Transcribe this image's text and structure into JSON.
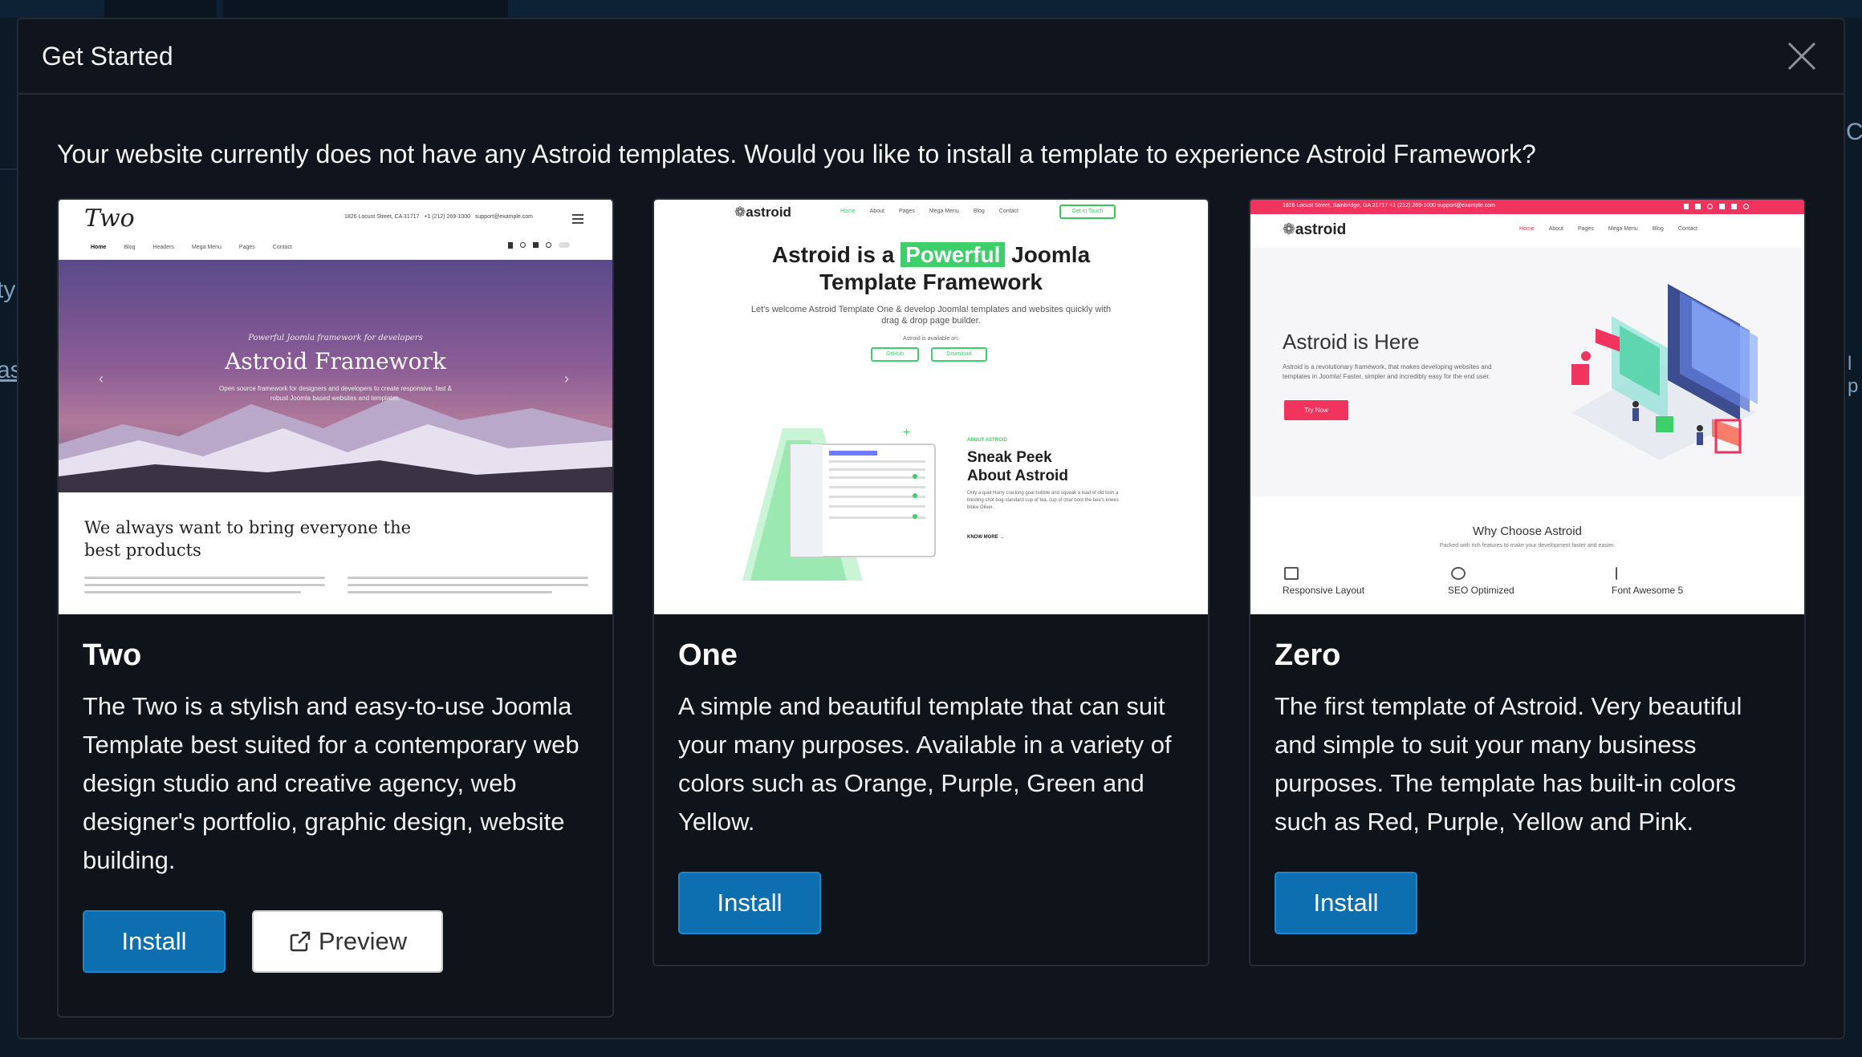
{
  "background": {
    "side_left_1": "ty",
    "side_left_2": "as",
    "side_right_1": "Cle",
    "side_right_2": "l p"
  },
  "modal": {
    "title": "Get Started",
    "close_icon": "close-icon",
    "intro": "Your website currently does not have any Astroid templates. Would you like to install a template to experience Astroid Framework?"
  },
  "templates": [
    {
      "title": "Two",
      "description": "The Two is a stylish and easy-to-use Joomla Template best suited for a contemporary web design studio and creative agency, web designer's portfolio, graphic design, website building.",
      "install_label": "Install",
      "preview_label": "Preview",
      "preview_icon": "external-link-icon",
      "thumb": {
        "logo": "Two",
        "address": "1826 Locust Street, CA 31717",
        "phone": "+1 (212) 269-1000",
        "email": "support@example.com",
        "nav": [
          "Home",
          "Blog",
          "Headers",
          "Mega Menu",
          "Pages",
          "Contact"
        ],
        "hero_script": "Powerful Joomla framework for developers",
        "hero_title": "Astroid Framework",
        "hero_subtitle": "Open source framework for designers and developers to create responsive, fast & robust Joomla based websites and templates.",
        "heading": "We always want to bring everyone the best products"
      }
    },
    {
      "title": "One",
      "description": "A simple and beautiful template that can suit your many purposes. Available in a variety of colors such as Orange, Purple, Green and Yellow.",
      "install_label": "Install",
      "thumb": {
        "logo": "astroid",
        "nav": [
          "Home",
          "About",
          "Pages",
          "Mega Menu",
          "Blog",
          "Contact"
        ],
        "cta": "Get in Touch",
        "title_pre": "Astroid is a",
        "title_highlight": "Powerful",
        "title_post": "Joomla",
        "title_line2": "Template Framework",
        "subtitle": "Let's welcome Astroid Template One & develop Joomla! templates and websites quickly with drag & drop page builder.",
        "available": "Astroid is available on:",
        "pill_1": "GitHub",
        "pill_2": "Download",
        "about_label": "ABOUT ASTROID",
        "peek_title": "Sneak Peek About Astroid",
        "peek_text": "Only a quid Harry cracking goal bubble and squeak a load of old tosh a blinding shot bog-standard cup of tea, cup of char boot the bee's knees bloke Oliver.",
        "know_more": "KNOW MORE →"
      }
    },
    {
      "title": "Zero",
      "description": "The first template of Astroid. Very beautiful and simple to suit your many business purposes. The template has built-in colors such as Red, Purple, Yellow and Pink.",
      "install_label": "Install",
      "thumb": {
        "logo": "astroid",
        "topbar": "1826 Locust Street, Bainbridge, GA 31717   +1 (212) 269-1000   support@example.com",
        "nav": [
          "Home",
          "About",
          "Pages",
          "Mega Menu",
          "Blog",
          "Contact"
        ],
        "heading": "Astroid is Here",
        "subtitle": "Astroid is a revolutionary framework, that makes developing websites and templates in Joomla! Faster, simpler and incredibly easy for the end user.",
        "cta": "Try Now",
        "why": "Why Choose Astroid",
        "why_sub": "Packed with rich features to make your development faster and easier.",
        "features": [
          "Responsive Layout",
          "SEO Optimized",
          "Font Awesome 5"
        ]
      }
    }
  ],
  "colors": {
    "accent": "#0e6fb0",
    "modal_bg": "#10141c",
    "brand_green": "#3dcf6a",
    "brand_pink": "#f0345d"
  }
}
